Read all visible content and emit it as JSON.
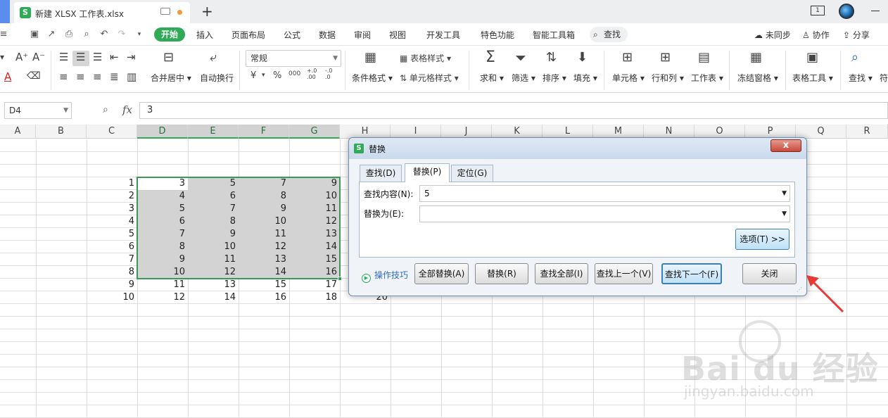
{
  "titlebar": {
    "doc_title": "新建 XLSX 工作表.xlsx",
    "new_tab_symbol": "+",
    "window_indicator": "1"
  },
  "menu": {
    "items": [
      "开始",
      "插入",
      "页面布局",
      "公式",
      "数据",
      "审阅",
      "视图",
      "开发工具",
      "特色功能",
      "智能工具箱"
    ],
    "search_label": "查找",
    "right_actions": [
      "未同步",
      "协作",
      "分享"
    ]
  },
  "ribbon": {
    "number_format": "常规",
    "labels": {
      "merge": "合并居中",
      "wrap": "自动换行",
      "table_style": "表格样式",
      "cell_style": "单元格样式",
      "cond_format": "条件格式",
      "sum": "求和",
      "filter": "筛选",
      "sort": "排序",
      "fill": "填充",
      "cell": "单元格",
      "rowcol": "行和列",
      "worksheet": "工作表",
      "freeze": "冻结窗格",
      "tabletools": "表格工具",
      "find": "查找",
      "symbol": "符"
    },
    "small_glyphs": {
      "currency": "¥",
      "percent": "%",
      "thousands": "000",
      "inc_decimal": "+.0\n.00",
      "dec_decimal": "-.0\n.0"
    }
  },
  "formula_bar": {
    "name_box": "D4",
    "fx": "fx",
    "value": "3"
  },
  "sheet": {
    "columns": [
      "A",
      "B",
      "C",
      "D",
      "E",
      "F",
      "G",
      "H",
      "I",
      "J",
      "K",
      "L",
      "M",
      "N",
      "O",
      "P",
      "Q",
      "R"
    ],
    "rows": [
      {
        "C": "1",
        "D": "3",
        "E": "5",
        "F": "7",
        "G": "9"
      },
      {
        "C": "2",
        "D": "4",
        "E": "6",
        "F": "8",
        "G": "10"
      },
      {
        "C": "3",
        "D": "5",
        "E": "7",
        "F": "9",
        "G": "11"
      },
      {
        "C": "4",
        "D": "6",
        "E": "8",
        "F": "10",
        "G": "12"
      },
      {
        "C": "5",
        "D": "7",
        "E": "9",
        "F": "11",
        "G": "13"
      },
      {
        "C": "6",
        "D": "8",
        "E": "10",
        "F": "12",
        "G": "14"
      },
      {
        "C": "7",
        "D": "9",
        "E": "11",
        "F": "13",
        "G": "15"
      },
      {
        "C": "8",
        "D": "10",
        "E": "12",
        "F": "14",
        "G": "16"
      },
      {
        "C": "9",
        "D": "11",
        "E": "13",
        "F": "15",
        "G": "17"
      },
      {
        "C": "10",
        "D": "12",
        "E": "14",
        "F": "16",
        "G": "18",
        "H": "20"
      }
    ]
  },
  "dialog": {
    "title": "替换",
    "close_symbol": "x",
    "tabs": [
      "查找(D)",
      "替换(P)",
      "定位(G)"
    ],
    "find_label": "查找内容(N):",
    "find_value": "5",
    "replace_label": "替换为(E):",
    "replace_value": "",
    "options_button": "选项(T) >>",
    "tips_link": "操作技巧",
    "buttons": [
      "全部替换(A)",
      "替换(R)",
      "查找全部(I)",
      "查找上一个(V)",
      "查找下一个(F)",
      "关闭"
    ]
  },
  "watermark": {
    "main": "Bai du 经验",
    "sub": "jingyan.baidu.com"
  },
  "colors": {
    "accent_green": "#2faa57",
    "selection_border": "#3a9a55",
    "annotation_arrow": "#e53935"
  }
}
